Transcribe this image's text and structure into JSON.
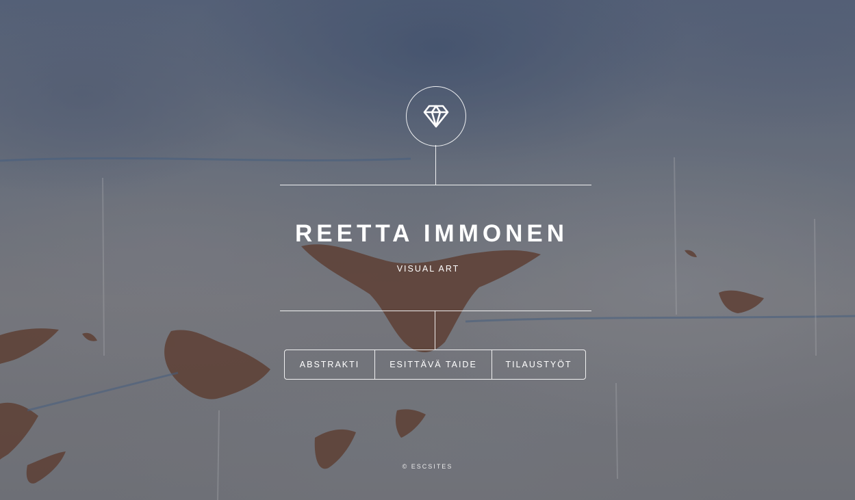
{
  "site": {
    "title": "REETTA IMMONEN",
    "subtitle": "VISUAL ART",
    "emblem_icon": "diamond-icon"
  },
  "nav": {
    "items": [
      {
        "label": "ABSTRAKTI"
      },
      {
        "label": "ESITTÄVÄ TAIDE"
      },
      {
        "label": "TILAUSTYÖT"
      }
    ]
  },
  "footer": {
    "credit": "© ESCSITES"
  },
  "colors": {
    "text": "#ffffff",
    "lines": "#ffffff",
    "background": "#6f7784"
  }
}
